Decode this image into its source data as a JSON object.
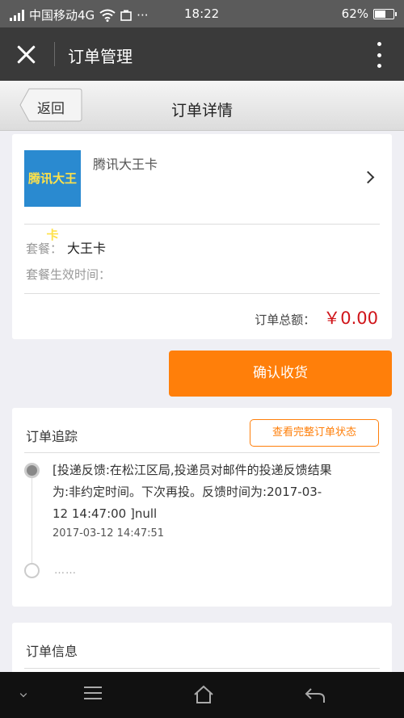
{
  "status_bar": {
    "carrier": "中国移动4G",
    "time": "18:22",
    "battery": "62%",
    "battery_level": 0.62
  },
  "app_bar": {
    "title": "订单管理"
  },
  "sub_header": {
    "back_label": "返回",
    "title": "订单详情"
  },
  "product": {
    "thumb_text": "腾讯大王卡",
    "name": "腾讯大王卡",
    "package_label": "套餐：",
    "package_value": "大王卡",
    "effective_time_label": "套餐生效时间："
  },
  "total": {
    "label": "订单总额：",
    "amount": "￥0.00"
  },
  "confirm_button": "确认收货",
  "tracking": {
    "title": "订单追踪",
    "view_status_button": "查看完整订单状态",
    "event_text": "[投递反馈:在松江区局,投递员对邮件的投递反馈结果为:非约定时间。下次再投。反馈时间为:2017-03-12 14:47:00 ]null",
    "event_time": "2017-03-12 14:47:51",
    "more": "……"
  },
  "order_info": {
    "title": "订单信息"
  },
  "colors": {
    "accent": "#ff7f0a",
    "price": "#d0151a",
    "app_bar": "#3a3a3a"
  }
}
